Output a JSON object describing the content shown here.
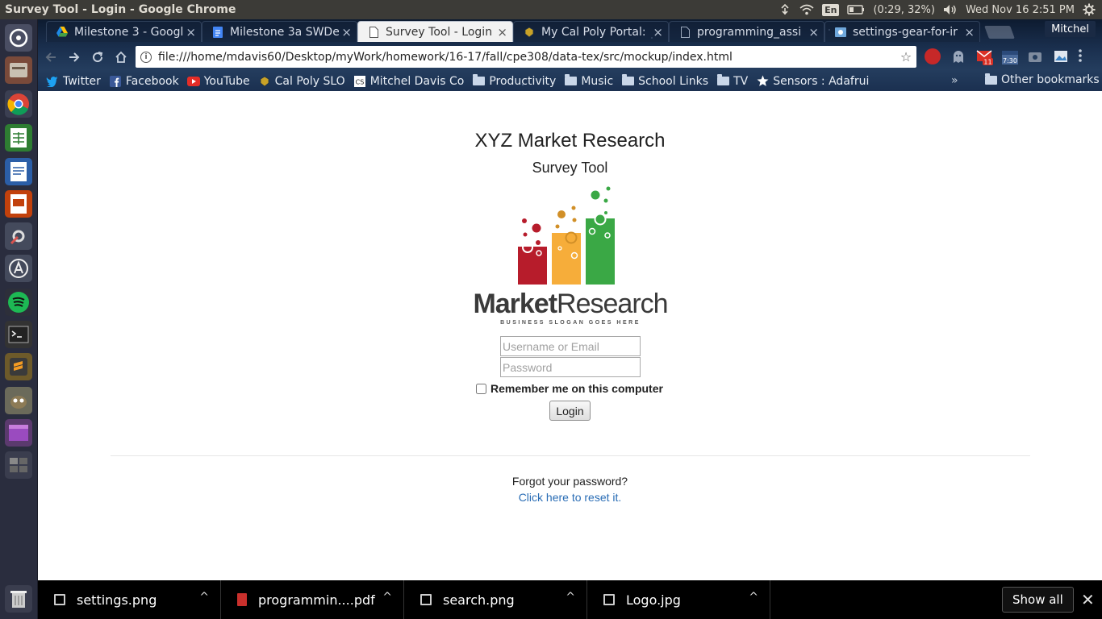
{
  "window": {
    "title": "Survey Tool - Login - Google Chrome"
  },
  "tray": {
    "language": "En",
    "battery": "(0:29, 32%)",
    "datetime": "Wed Nov 16  2:51 PM"
  },
  "tabs": [
    {
      "label": "Milestone 3 - Googl",
      "active": false
    },
    {
      "label": "Milestone 3a SWDe",
      "active": false
    },
    {
      "label": "Survey Tool - Login",
      "active": true
    },
    {
      "label": "My Cal Poly Portal:",
      "active": false
    },
    {
      "label": "programming_assi",
      "active": false
    },
    {
      "label": "settings-gear-for-ir",
      "active": false
    }
  ],
  "profile": {
    "name": "Mitchel"
  },
  "omnibox": {
    "url": "file:///home/mdavis60/Desktop/myWork/homework/16-17/fall/cpe308/data-tex/src/mockup/index.html"
  },
  "extensions": {
    "mail_badge": "11",
    "calendar_badge": "7:30"
  },
  "bookmarks": [
    {
      "label": "Twitter",
      "icon": "twitter-icon"
    },
    {
      "label": "Facebook",
      "icon": "facebook-icon"
    },
    {
      "label": "YouTube",
      "icon": "youtube-icon"
    },
    {
      "label": "Cal Poly SLO",
      "icon": "calpoly-icon"
    },
    {
      "label": "Mitchel Davis Co",
      "icon": "cs-icon"
    },
    {
      "label": "Productivity",
      "icon": "folder-icon"
    },
    {
      "label": "Music",
      "icon": "folder-icon"
    },
    {
      "label": "School Links",
      "icon": "folder-icon"
    },
    {
      "label": "TV",
      "icon": "folder-icon"
    },
    {
      "label": "Sensors : Adafrui",
      "icon": "star-icon"
    }
  ],
  "bookmarks_more": "»",
  "other_bookmarks": "Other bookmarks",
  "page": {
    "title": "XYZ Market Research",
    "subtitle": "Survey Tool",
    "logo": {
      "word_bold": "Market",
      "word_regular": "Research",
      "slogan": "BUSINESS SLOGAN GOES HERE"
    },
    "username_placeholder": "Username or Email",
    "password_placeholder": "Password",
    "remember_label": "Remember me on this computer",
    "login_label": "Login",
    "forgot_text": "Forgot your password?",
    "reset_link": "Click here to reset it."
  },
  "downloads": {
    "items": [
      {
        "name": "settings.png",
        "type": "image"
      },
      {
        "name": "programmin....pdf",
        "type": "pdf"
      },
      {
        "name": "search.png",
        "type": "image"
      },
      {
        "name": "Logo.jpg",
        "type": "image"
      }
    ],
    "show_all": "Show all",
    "close": "✕"
  }
}
